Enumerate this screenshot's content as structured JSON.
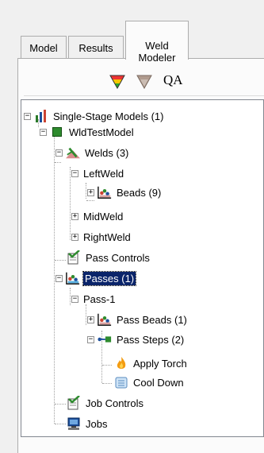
{
  "tabs": [
    {
      "label": "Model",
      "active": false
    },
    {
      "label": "Results",
      "active": false
    },
    {
      "label": "Weld\nModeler",
      "active": true
    }
  ],
  "toolbar": {
    "qa_label": "QA",
    "icons": [
      "filter-color-icon",
      "filter-gray-icon"
    ]
  },
  "tree": {
    "root": "Single-Stage Models (1)",
    "model": "WldTestModel",
    "welds": "Welds (3)",
    "left_weld": "LeftWeld",
    "beads": "Beads (9)",
    "mid_weld": "MidWeld",
    "right_weld": "RightWeld",
    "pass_controls": "Pass Controls",
    "passes": "Passes (1)",
    "pass1": "Pass-1",
    "pass_beads": "Pass Beads (1)",
    "pass_steps": "Pass Steps (2)",
    "apply_torch": "Apply Torch",
    "cool_down": "Cool Down",
    "job_controls": "Job Controls",
    "jobs": "Jobs"
  },
  "colors": {
    "selection": "#0a246a",
    "accent_green": "#2e8b2e"
  }
}
